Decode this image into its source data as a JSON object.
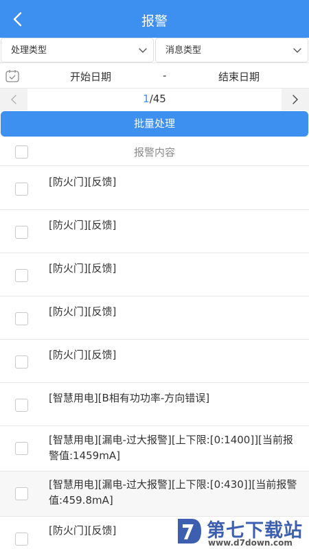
{
  "header": {
    "title": "报警",
    "back_icon": "chevron-left-icon"
  },
  "filters": {
    "handle_type": "处理类型",
    "message_type": "消息类型"
  },
  "dates": {
    "start": "开始日期",
    "separator": "-",
    "end": "结束日期"
  },
  "pager": {
    "current": "1",
    "total": "/45"
  },
  "batch_button": "批量处理",
  "list": {
    "header": "报警内容",
    "rows": [
      {
        "text": "[防火门][反馈]",
        "checked": false,
        "highlighted": false
      },
      {
        "text": "[防火门][反馈]",
        "checked": false,
        "highlighted": false
      },
      {
        "text": "[防火门][反馈]",
        "checked": false,
        "highlighted": false
      },
      {
        "text": "[防火门][反馈]",
        "checked": false,
        "highlighted": false
      },
      {
        "text": "[防火门][反馈]",
        "checked": false,
        "highlighted": false
      },
      {
        "text": "[智慧用电][B相有功功率-方向错误]",
        "checked": false,
        "highlighted": false
      },
      {
        "text": "[智慧用电][漏电-过大报警][上下限:[0:1400]][当前报警值:1459mA]",
        "checked": false,
        "highlighted": false
      },
      {
        "text": "[智慧用电][漏电-过大报警][上下限:[0:430]][当前报警值:459.8mA]",
        "checked": false,
        "highlighted": true
      },
      {
        "text": "[防火门][反馈]",
        "checked": false,
        "highlighted": false
      }
    ]
  },
  "watermark": {
    "brand": "第七下载站",
    "url": "www.d7down.com"
  },
  "colors": {
    "accent": "#3d8ff0",
    "divider": "#e8e8e8",
    "watermark": "#3d5fb0"
  }
}
